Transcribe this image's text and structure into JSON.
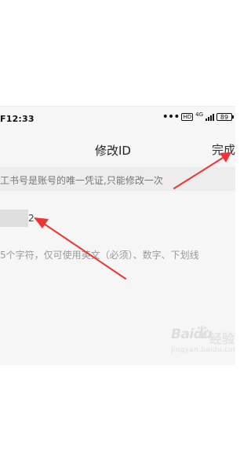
{
  "status_bar": {
    "time": "F12:33",
    "hd": "HD",
    "network": "4G",
    "battery": "89"
  },
  "navigation": {
    "title": "修改ID",
    "done_label": "完成"
  },
  "notice": {
    "text": "工书号是账号的唯一凭证,只能修改一次"
  },
  "id_field": {
    "visible_tail": "2"
  },
  "rules": {
    "text": "5个字符，仅可使用英文（必须）、数字、下划线"
  },
  "watermark": {
    "brand": "Baidu",
    "experience": "经验",
    "domain": "jingyan.baidu.com"
  },
  "colors": {
    "background": "#ffffff",
    "screen": "#f6f6f6",
    "notice_bar": "#ededed",
    "arrow": "#ef3434",
    "text": "#222222",
    "secondary_text": "#999999"
  },
  "icons": [
    "menu-dots-icon",
    "hd-icon",
    "network-4g-icon",
    "signal-icon",
    "battery-icon",
    "red-arrow-annotation",
    "baidu-paw-icon"
  ]
}
